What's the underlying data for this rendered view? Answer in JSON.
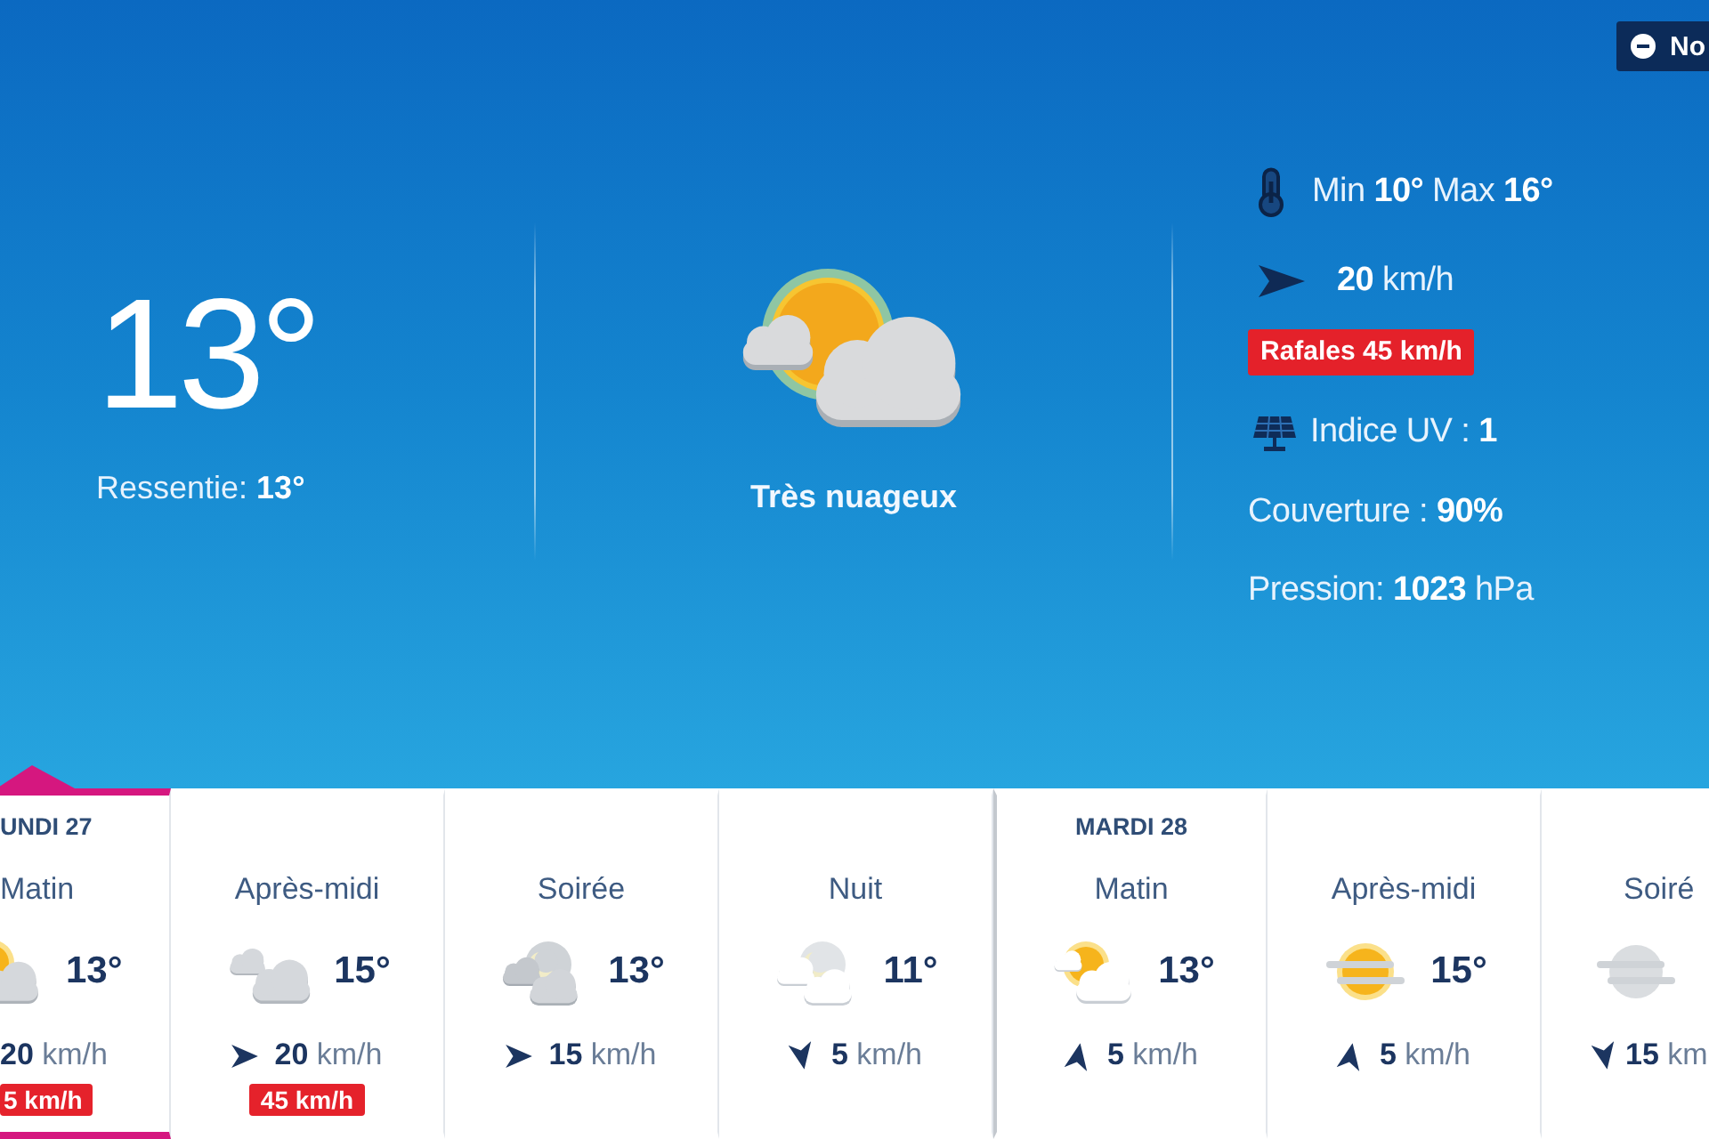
{
  "top_button": {
    "label": "No"
  },
  "current": {
    "temperature": "13°",
    "feels_like": "Ressentie: **13°**",
    "condition": "Très nuageux"
  },
  "details": {
    "min_max": "Min **10°** Max **16°**",
    "wind": "**20** km/h",
    "gusts": "Rafales 45 km/h",
    "uv_index": "Indice UV : **1**",
    "cloud_cover": "Couverture : **90%**",
    "pressure": "Pression: **1023** hPa"
  },
  "forecast": [
    {
      "day": "UNDI 27",
      "period": "Matin",
      "kind": "partlycloudy",
      "temperature": "13°",
      "wind": {
        "speed": "**20** km/h"
      },
      "gust": "5 km/h",
      "selected": true
    },
    {
      "period": "Après-midi",
      "kind": "cloudy",
      "temperature": "15°",
      "wind": {
        "kind": "east",
        "speed": "**20** km/h"
      },
      "gust": "45 km/h",
      "selected": false
    },
    {
      "period": "Soirée",
      "kind": "nightcloudy",
      "temperature": "13°",
      "wind": {
        "kind": "east",
        "speed": "**15** km/h"
      },
      "selected": false
    },
    {
      "period": "Nuit",
      "kind": "nightpartly",
      "temperature": "11°",
      "wind": {
        "kind": "south",
        "speed": "**5** km/h"
      },
      "selected": false
    },
    {
      "day": "MARDI 28",
      "period": "Matin",
      "kind": "partlysunny",
      "temperature": "13°",
      "wind": {
        "kind": "north",
        "speed": "**5** km/h"
      },
      "selected": false
    },
    {
      "period": "Après-midi",
      "kind": "hazy",
      "temperature": "15°",
      "wind": {
        "kind": "north",
        "speed": "**5** km/h"
      },
      "selected": false
    },
    {
      "period": "Soiré",
      "kind": "nightfog",
      "wind": {
        "kind": "south",
        "speed": "**15** km"
      },
      "selected": false
    }
  ]
}
